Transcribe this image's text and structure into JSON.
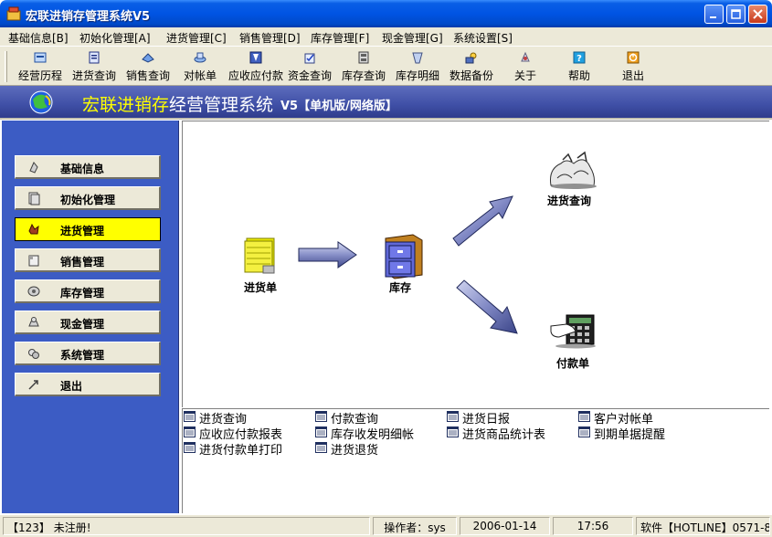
{
  "window": {
    "title": "宏联进销存管理系统V5"
  },
  "menu": [
    {
      "label": "基础信息[B]"
    },
    {
      "label": "初始化管理[A]"
    },
    {
      "label": "进货管理[C]"
    },
    {
      "label": "销售管理[D]"
    },
    {
      "label": "库存管理[F]"
    },
    {
      "label": "现金管理[G]"
    },
    {
      "label": "系统设置[S]"
    }
  ],
  "toolbar": [
    {
      "label": "经营历程",
      "icon": "history-icon"
    },
    {
      "label": "进货查询",
      "icon": "purchase-query-icon"
    },
    {
      "label": "销售查询",
      "icon": "sales-query-icon"
    },
    {
      "label": "对帐单",
      "icon": "statement-icon"
    },
    {
      "label": "应收应付款",
      "icon": "receivable-icon"
    },
    {
      "label": "资金查询",
      "icon": "funds-icon"
    },
    {
      "label": "库存查询",
      "icon": "inventory-query-icon"
    },
    {
      "label": "库存明细",
      "icon": "inventory-detail-icon"
    },
    {
      "label": "数据备份",
      "icon": "backup-icon"
    },
    {
      "label": "关于",
      "icon": "about-icon"
    },
    {
      "label": "帮助",
      "icon": "help-icon"
    },
    {
      "label": "退出",
      "icon": "exit-icon"
    }
  ],
  "banner": {
    "title_highlight": "宏联进销存",
    "title_rest": "经营管理系统",
    "edition": "V5【单机版/网络版】"
  },
  "sidebar": [
    {
      "label": "基础信息",
      "active": false
    },
    {
      "label": "初始化管理",
      "active": false
    },
    {
      "label": "进货管理",
      "active": true
    },
    {
      "label": "销售管理",
      "active": false
    },
    {
      "label": "库存管理",
      "active": false
    },
    {
      "label": "现金管理",
      "active": false
    },
    {
      "label": "系统管理",
      "active": false
    },
    {
      "label": "退出",
      "active": false
    }
  ],
  "diagram": {
    "purchase_order": "进货单",
    "inventory": "库存",
    "purchase_query": "进货查询",
    "payment_order": "付款单"
  },
  "links": [
    {
      "label": "进货查询"
    },
    {
      "label": "付款查询"
    },
    {
      "label": "进货日报"
    },
    {
      "label": "客户对帐单"
    },
    {
      "label": "应收应付款报表"
    },
    {
      "label": "库存收发明细帐"
    },
    {
      "label": "进货商品统计表"
    },
    {
      "label": "到期单据提醒"
    },
    {
      "label": "进货付款单打印"
    },
    {
      "label": "进货退货"
    }
  ],
  "status": {
    "registration": "【123】 未注册!",
    "operator": "操作者：sys",
    "date": "2006-01-14",
    "time": "17:56",
    "hotline": "软件【HOTLINE】0571-8"
  },
  "colors": {
    "titlebar": "#0054e3",
    "sidebar": "#3c5cc4",
    "active_button": "#ffff00",
    "banner_highlight": "#ffff00"
  }
}
